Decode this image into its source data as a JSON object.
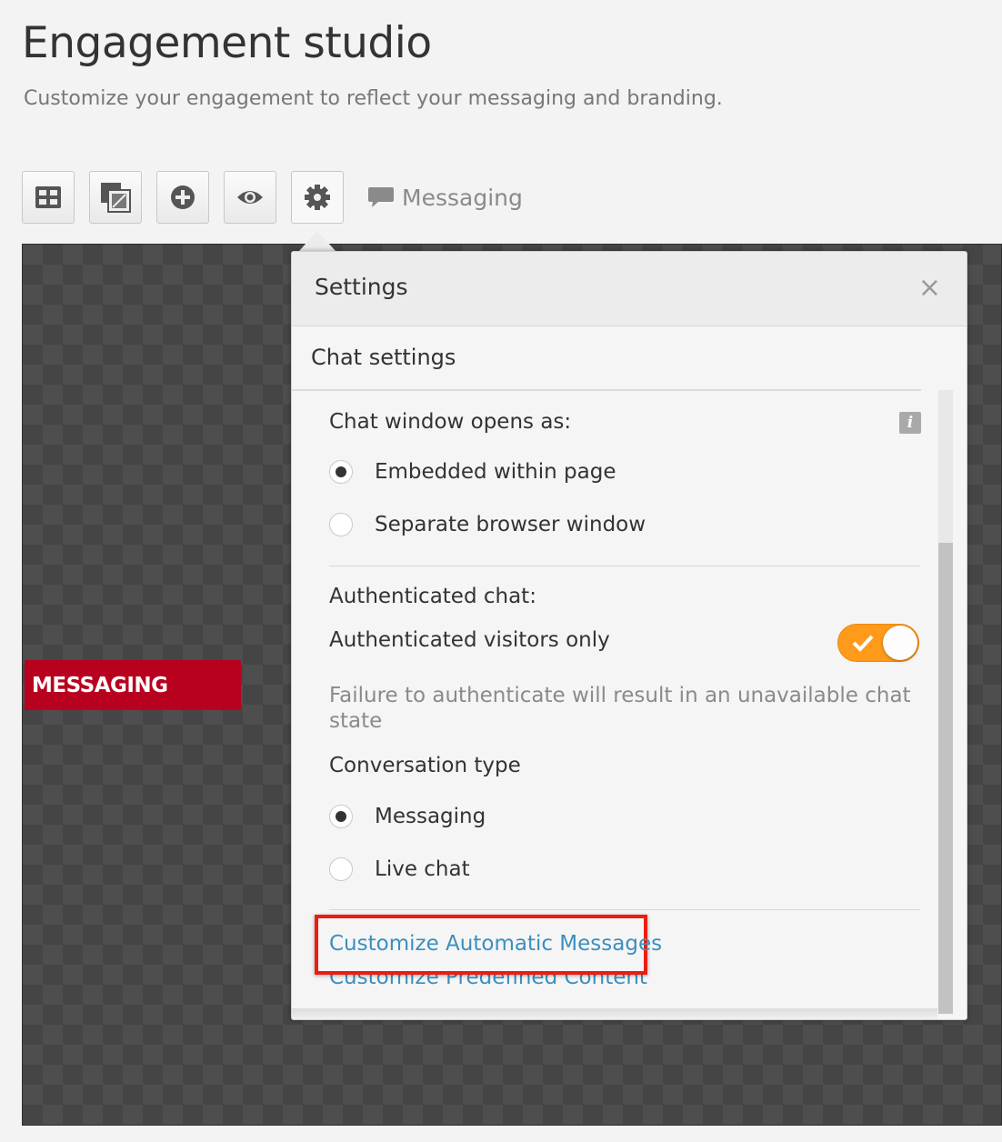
{
  "page": {
    "title": "Engagement studio",
    "subtitle": "Customize your engagement to reflect your messaging and branding."
  },
  "toolbar": {
    "buttons": [
      {
        "icon": "layout-gallery-icon"
      },
      {
        "icon": "image-edit-icon"
      },
      {
        "icon": "add-circle-icon"
      },
      {
        "icon": "eye-icon"
      },
      {
        "icon": "gear-icon",
        "active": true
      }
    ],
    "channel_icon": "chat-bubble-icon",
    "channel_label": "Messaging"
  },
  "canvas": {
    "engagement_button_label": "MESSAGING",
    "engagement_button_color": "#b8001f"
  },
  "settings_panel": {
    "title": "Settings",
    "close_label": "×",
    "section_title": "Chat settings",
    "chat_window": {
      "label": "Chat window opens as:",
      "info_icon": "i",
      "options": [
        "Embedded within page",
        "Separate browser window"
      ],
      "selected": "Embedded within page"
    },
    "authenticated": {
      "label": "Authenticated chat:",
      "toggle_label": "Authenticated visitors only",
      "toggle_on": true,
      "toggle_color": "#ff9a1b",
      "help_text": "Failure to authenticate will result in an unavailable chat state"
    },
    "conversation": {
      "label": "Conversation type",
      "options": [
        "Messaging",
        "Live chat"
      ],
      "selected": "Messaging"
    },
    "links": [
      "Customize Automatic Messages",
      "Customize Predefined Content"
    ],
    "link_color": "#3b8fbf",
    "highlight_color": "#ee1c10"
  }
}
